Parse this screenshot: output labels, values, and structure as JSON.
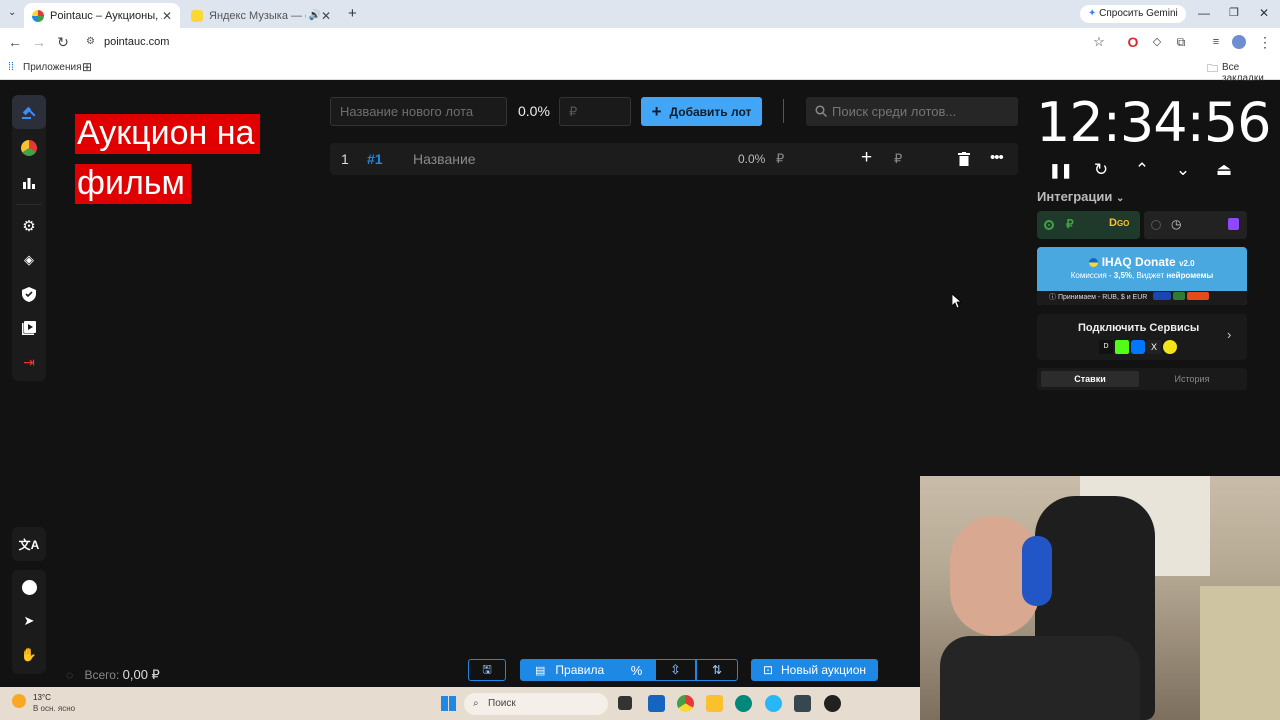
{
  "browser": {
    "tabs": [
      {
        "title": "Pointauc – Аукционы, лотереи…",
        "active": true
      },
      {
        "title": "Яндекс Музыка — собирай…",
        "active": false
      }
    ],
    "url": "pointauc.com",
    "gemini_label": "Спросить Gemini",
    "bookmarks_apps": "Приложения",
    "bookmarks_all": "Все закладки"
  },
  "sidebar": {
    "items": [
      {
        "name": "auction",
        "icon": "gavel-icon",
        "active": true
      },
      {
        "name": "wheel",
        "icon": "pie-chart-icon"
      },
      {
        "name": "stats",
        "icon": "bar-chart-icon"
      },
      {
        "name": "settings",
        "icon": "gear-icon"
      },
      {
        "name": "layers",
        "icon": "layers-icon"
      },
      {
        "name": "shield",
        "icon": "shield-icon"
      },
      {
        "name": "video",
        "icon": "video-library-icon"
      },
      {
        "name": "logout",
        "icon": "logout-icon"
      }
    ],
    "bottom": [
      {
        "name": "language",
        "icon": "translate-icon"
      },
      {
        "name": "github",
        "icon": "github-icon"
      },
      {
        "name": "telegram",
        "icon": "telegram-icon"
      },
      {
        "name": "donate",
        "icon": "donate-hand-icon"
      }
    ]
  },
  "auction_title": "Аукцион на фильм",
  "new_lot": {
    "name_placeholder": "Название нового лота",
    "percent": "0.0%",
    "amount_placeholder": "₽",
    "add_button": "Добавить лот"
  },
  "search": {
    "placeholder": "Поиск среди лотов..."
  },
  "lots": [
    {
      "index": "1",
      "id": "#1",
      "name": "Название",
      "percent": "0.0%",
      "currency": "₽",
      "add_currency": "₽"
    }
  ],
  "timer": "12:34:56",
  "integrations": {
    "label": "Интеграции",
    "ihaq": {
      "title": "IHAQ Donate",
      "version": "v2.0",
      "line1_pre": "Комиссия - ",
      "fee": "3,5%",
      "line1_mid": ", Виджет ",
      "widget": "нейромемы",
      "line2": "Принимаем - RUB, $ и EUR"
    },
    "connect": "Подключить Сервисы",
    "tabs": [
      "Ставки",
      "История"
    ]
  },
  "bottom_bar": {
    "rules": "Правила",
    "new_auction": "Новый аукцион",
    "total_label": "Всего:",
    "total_value": "0,00 ₽"
  },
  "taskbar": {
    "weather_temp": "13°C",
    "weather_desc": "В осн. ясно",
    "search_placeholder": "Поиск"
  },
  "colors": {
    "accent": "#42a5f5",
    "title_bg": "#e00000",
    "background": "#121212"
  }
}
